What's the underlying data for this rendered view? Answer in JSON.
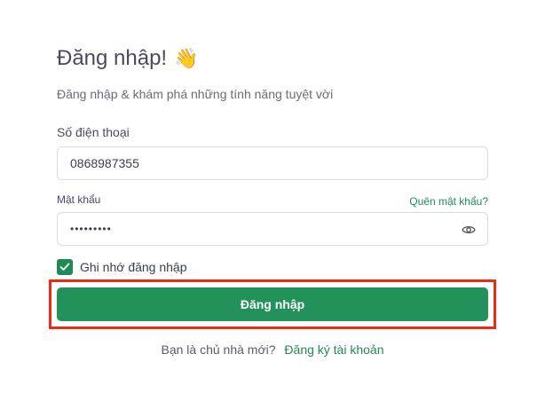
{
  "header": {
    "title": "Đăng nhập!",
    "title_emoji": "👋",
    "subtitle": "Đăng nhập & khám phá những tính năng tuyệt vời"
  },
  "form": {
    "phone_label": "Số điện thoại",
    "phone_value": "0868987355",
    "password_label": "Mật khẩu",
    "password_value": "•••••••••",
    "forgot_link": "Quên mật khẩu?",
    "remember_label": "Ghi nhớ đăng nhập",
    "remember_checked": true,
    "submit_label": "Đăng nhập"
  },
  "footer": {
    "prompt": "Bạn là chủ nhà mới?",
    "register_link": "Đăng ký tài khoản"
  },
  "colors": {
    "accent": "#23915a",
    "highlight": "#ee2a12"
  },
  "icons": {
    "password_toggle": "eye-icon",
    "checkbox": "check-icon"
  }
}
